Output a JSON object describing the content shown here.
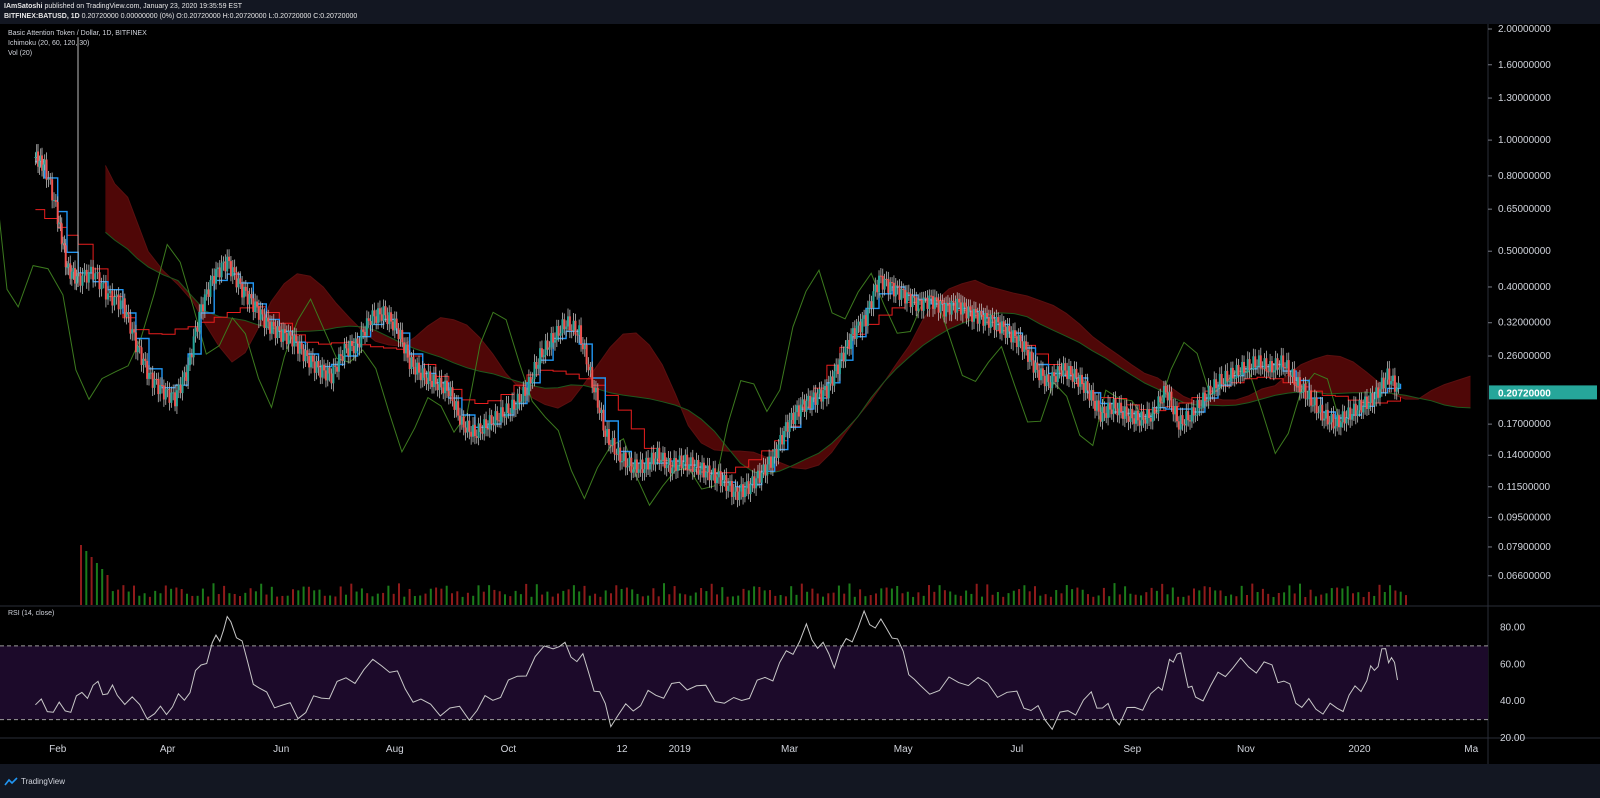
{
  "header": {
    "author": "IAmSatoshi",
    "published_text": "published on TradingView.com, January 23, 2020 19:35:59 EST",
    "symbol": "BITFINEX:BATUSD, 1D",
    "ohlc_text": "0.20720000 0.00000000 (0%) O:0.20720000 H:0.20720000 L:0.20720000 C:0.20720000"
  },
  "legend": {
    "title": "Basic Attention Token / Dollar, 1D, BITFINEX",
    "indicator1": "Ichimoku (20, 60, 120, 30)",
    "indicator2": "Vol (20)",
    "rsi": "RSI (14, close)"
  },
  "footer": {
    "brand": "TradingView",
    "logo": "tradingview-logo-icon"
  },
  "colors": {
    "background": "#000000",
    "up": "#26a69a",
    "down": "#ef5350",
    "conversion_line": "#2196f3",
    "base_line": "#e91e1e",
    "lagging_span": "#3c7a1e",
    "cloud_bear": "#7a0a0a",
    "cloud_bull": "#0d3d0d",
    "price_label_bg": "#26a69a",
    "rsi_band": "#1c0a2a",
    "rsi_line": "#c8c8c8"
  },
  "chart_data": {
    "type": "candlestick",
    "title": "Basic Attention Token / Dollar, 1D, BITFINEX",
    "y_scale": "log",
    "ylim": [
      0.055,
      2.0
    ],
    "y_ticks": [
      "2.00000000",
      "1.60000000",
      "1.30000000",
      "1.00000000",
      "0.80000000",
      "0.65000000",
      "0.50000000",
      "0.40000000",
      "0.32000000",
      "0.26000000",
      "0.17000000",
      "0.14000000",
      "0.11500000",
      "0.09500000",
      "0.07900000",
      "0.06600000"
    ],
    "last_price_label": "0.20720000",
    "last_price": 0.2072,
    "x_ticks": [
      "Feb",
      "Apr",
      "Jun",
      "Aug",
      "Oct",
      "12",
      "2019",
      "Mar",
      "May",
      "Jul",
      "Sep",
      "Nov",
      "2020",
      "Ma"
    ],
    "x_start": "2018-01-01",
    "x_end": "2020-03-10",
    "price_series": [
      {
        "d": "2018-01-20",
        "v": 0.9
      },
      {
        "d": "2018-01-25",
        "v": 0.85
      },
      {
        "d": "2018-02-01",
        "v": 0.62
      },
      {
        "d": "2018-02-06",
        "v": 0.45
      },
      {
        "d": "2018-02-12",
        "v": 0.42
      },
      {
        "d": "2018-02-20",
        "v": 0.44
      },
      {
        "d": "2018-02-28",
        "v": 0.38
      },
      {
        "d": "2018-03-08",
        "v": 0.36
      },
      {
        "d": "2018-03-15",
        "v": 0.28
      },
      {
        "d": "2018-03-22",
        "v": 0.23
      },
      {
        "d": "2018-03-29",
        "v": 0.21
      },
      {
        "d": "2018-04-05",
        "v": 0.2
      },
      {
        "d": "2018-04-12",
        "v": 0.24
      },
      {
        "d": "2018-04-19",
        "v": 0.35
      },
      {
        "d": "2018-04-26",
        "v": 0.43
      },
      {
        "d": "2018-05-03",
        "v": 0.47
      },
      {
        "d": "2018-05-10",
        "v": 0.4
      },
      {
        "d": "2018-05-17",
        "v": 0.36
      },
      {
        "d": "2018-05-24",
        "v": 0.32
      },
      {
        "d": "2018-05-31",
        "v": 0.3
      },
      {
        "d": "2018-06-07",
        "v": 0.29
      },
      {
        "d": "2018-06-14",
        "v": 0.26
      },
      {
        "d": "2018-06-21",
        "v": 0.24
      },
      {
        "d": "2018-06-28",
        "v": 0.23
      },
      {
        "d": "2018-07-05",
        "v": 0.27
      },
      {
        "d": "2018-07-12",
        "v": 0.28
      },
      {
        "d": "2018-07-19",
        "v": 0.33
      },
      {
        "d": "2018-07-26",
        "v": 0.34
      },
      {
        "d": "2018-08-02",
        "v": 0.31
      },
      {
        "d": "2018-08-09",
        "v": 0.25
      },
      {
        "d": "2018-08-16",
        "v": 0.23
      },
      {
        "d": "2018-08-23",
        "v": 0.22
      },
      {
        "d": "2018-08-30",
        "v": 0.21
      },
      {
        "d": "2018-09-06",
        "v": 0.17
      },
      {
        "d": "2018-09-13",
        "v": 0.16
      },
      {
        "d": "2018-09-20",
        "v": 0.17
      },
      {
        "d": "2018-09-27",
        "v": 0.18
      },
      {
        "d": "2018-10-04",
        "v": 0.19
      },
      {
        "d": "2018-10-11",
        "v": 0.21
      },
      {
        "d": "2018-10-18",
        "v": 0.26
      },
      {
        "d": "2018-10-25",
        "v": 0.29
      },
      {
        "d": "2018-11-01",
        "v": 0.32
      },
      {
        "d": "2018-11-08",
        "v": 0.3
      },
      {
        "d": "2018-11-15",
        "v": 0.22
      },
      {
        "d": "2018-11-22",
        "v": 0.16
      },
      {
        "d": "2018-11-29",
        "v": 0.14
      },
      {
        "d": "2018-12-06",
        "v": 0.13
      },
      {
        "d": "2018-12-13",
        "v": 0.13
      },
      {
        "d": "2018-12-20",
        "v": 0.14
      },
      {
        "d": "2018-12-27",
        "v": 0.13
      },
      {
        "d": "2019-01-03",
        "v": 0.135
      },
      {
        "d": "2019-01-10",
        "v": 0.13
      },
      {
        "d": "2019-01-17",
        "v": 0.125
      },
      {
        "d": "2019-01-24",
        "v": 0.12
      },
      {
        "d": "2019-01-31",
        "v": 0.11
      },
      {
        "d": "2019-02-07",
        "v": 0.115
      },
      {
        "d": "2019-02-14",
        "v": 0.125
      },
      {
        "d": "2019-02-21",
        "v": 0.14
      },
      {
        "d": "2019-02-28",
        "v": 0.17
      },
      {
        "d": "2019-03-07",
        "v": 0.19
      },
      {
        "d": "2019-03-14",
        "v": 0.2
      },
      {
        "d": "2019-03-21",
        "v": 0.21
      },
      {
        "d": "2019-03-28",
        "v": 0.25
      },
      {
        "d": "2019-04-04",
        "v": 0.3
      },
      {
        "d": "2019-04-11",
        "v": 0.33
      },
      {
        "d": "2019-04-18",
        "v": 0.42
      },
      {
        "d": "2019-04-25",
        "v": 0.4
      },
      {
        "d": "2019-05-02",
        "v": 0.38
      },
      {
        "d": "2019-05-09",
        "v": 0.36
      },
      {
        "d": "2019-05-16",
        "v": 0.37
      },
      {
        "d": "2019-05-23",
        "v": 0.35
      },
      {
        "d": "2019-05-30",
        "v": 0.36
      },
      {
        "d": "2019-06-06",
        "v": 0.34
      },
      {
        "d": "2019-06-13",
        "v": 0.33
      },
      {
        "d": "2019-06-20",
        "v": 0.32
      },
      {
        "d": "2019-06-27",
        "v": 0.3
      },
      {
        "d": "2019-07-04",
        "v": 0.28
      },
      {
        "d": "2019-07-11",
        "v": 0.24
      },
      {
        "d": "2019-07-18",
        "v": 0.22
      },
      {
        "d": "2019-07-25",
        "v": 0.24
      },
      {
        "d": "2019-08-01",
        "v": 0.23
      },
      {
        "d": "2019-08-08",
        "v": 0.21
      },
      {
        "d": "2019-08-15",
        "v": 0.18
      },
      {
        "d": "2019-08-22",
        "v": 0.19
      },
      {
        "d": "2019-08-29",
        "v": 0.18
      },
      {
        "d": "2019-09-05",
        "v": 0.175
      },
      {
        "d": "2019-09-12",
        "v": 0.18
      },
      {
        "d": "2019-09-19",
        "v": 0.21
      },
      {
        "d": "2019-09-26",
        "v": 0.17
      },
      {
        "d": "2019-10-03",
        "v": 0.18
      },
      {
        "d": "2019-10-10",
        "v": 0.2
      },
      {
        "d": "2019-10-17",
        "v": 0.22
      },
      {
        "d": "2019-10-24",
        "v": 0.23
      },
      {
        "d": "2019-10-31",
        "v": 0.24
      },
      {
        "d": "2019-11-07",
        "v": 0.25
      },
      {
        "d": "2019-11-14",
        "v": 0.24
      },
      {
        "d": "2019-11-21",
        "v": 0.25
      },
      {
        "d": "2019-11-28",
        "v": 0.22
      },
      {
        "d": "2019-12-05",
        "v": 0.2
      },
      {
        "d": "2019-12-12",
        "v": 0.18
      },
      {
        "d": "2019-12-19",
        "v": 0.17
      },
      {
        "d": "2019-12-26",
        "v": 0.18
      },
      {
        "d": "2020-01-02",
        "v": 0.19
      },
      {
        "d": "2020-01-09",
        "v": 0.2
      },
      {
        "d": "2020-01-16",
        "v": 0.23
      },
      {
        "d": "2020-01-23",
        "v": 0.2072
      }
    ],
    "rsi": {
      "ylim": [
        20,
        90
      ],
      "ticks": [
        "80.00",
        "60.00",
        "40.00",
        "20.00"
      ],
      "overbought": 70,
      "oversold": 30,
      "series": [
        {
          "d": "2018-01-20",
          "v": 38
        },
        {
          "d": "2018-02-05",
          "v": 35
        },
        {
          "d": "2018-02-20",
          "v": 48
        },
        {
          "d": "2018-03-05",
          "v": 44
        },
        {
          "d": "2018-03-25",
          "v": 32
        },
        {
          "d": "2018-04-10",
          "v": 42
        },
        {
          "d": "2018-04-25",
          "v": 70
        },
        {
          "d": "2018-05-05",
          "v": 85
        },
        {
          "d": "2018-05-20",
          "v": 45
        },
        {
          "d": "2018-06-10",
          "v": 33
        },
        {
          "d": "2018-07-01",
          "v": 48
        },
        {
          "d": "2018-07-25",
          "v": 62
        },
        {
          "d": "2018-08-15",
          "v": 38
        },
        {
          "d": "2018-09-10",
          "v": 33
        },
        {
          "d": "2018-10-01",
          "v": 48
        },
        {
          "d": "2018-10-25",
          "v": 72
        },
        {
          "d": "2018-11-10",
          "v": 62
        },
        {
          "d": "2018-11-25",
          "v": 30
        },
        {
          "d": "2018-12-15",
          "v": 42
        },
        {
          "d": "2019-01-05",
          "v": 50
        },
        {
          "d": "2019-01-30",
          "v": 38
        },
        {
          "d": "2019-02-20",
          "v": 55
        },
        {
          "d": "2019-03-10",
          "v": 78
        },
        {
          "d": "2019-03-25",
          "v": 62
        },
        {
          "d": "2019-04-10",
          "v": 85
        },
        {
          "d": "2019-04-25",
          "v": 78
        },
        {
          "d": "2019-05-10",
          "v": 45
        },
        {
          "d": "2019-06-05",
          "v": 52
        },
        {
          "d": "2019-07-01",
          "v": 42
        },
        {
          "d": "2019-07-20",
          "v": 28
        },
        {
          "d": "2019-08-10",
          "v": 42
        },
        {
          "d": "2019-08-25",
          "v": 30
        },
        {
          "d": "2019-09-15",
          "v": 45
        },
        {
          "d": "2019-09-25",
          "v": 68
        },
        {
          "d": "2019-10-05",
          "v": 40
        },
        {
          "d": "2019-10-25",
          "v": 60
        },
        {
          "d": "2019-11-15",
          "v": 58
        },
        {
          "d": "2019-12-01",
          "v": 38
        },
        {
          "d": "2019-12-20",
          "v": 35
        },
        {
          "d": "2020-01-05",
          "v": 52
        },
        {
          "d": "2020-01-15",
          "v": 68
        },
        {
          "d": "2020-01-23",
          "v": 52
        }
      ]
    }
  }
}
